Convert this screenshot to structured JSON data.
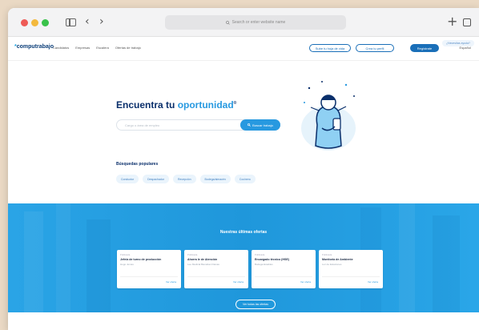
{
  "browser": {
    "address_placeholder": "Search or enter website name"
  },
  "site": {
    "logo": "computrabajo",
    "nav_links": [
      "Candidatos",
      "Empresas",
      "Escalera",
      "Ofertas de trabajo"
    ],
    "buttons": {
      "upload_cv": "Sube tu hoja de vida",
      "create_profile": "Crea tu perfil",
      "register": "Regístrate"
    },
    "language": "Español",
    "help_chip": "¿Necesitas ayuda?"
  },
  "hero": {
    "title_main": "Encuentra tu ",
    "title_accent": "oportunidad",
    "title_mark": "®",
    "search_placeholder": "Cargo o área de empleo",
    "search_button": "Buscar trabajo"
  },
  "popular": {
    "title": "Búsquedas populares",
    "chips": [
      "Conductor",
      "Despachador",
      "Recepción",
      "Bodega/almacén",
      "Cocinero"
    ]
  },
  "offers": {
    "title": "Nuestras últimas ofertas",
    "cards": [
      {
        "label": "Publicada",
        "title": "Jefe/a de turno de producción",
        "company": "Hugo Jemas",
        "more": "Ver oferta"
      },
      {
        "label": "Publicada",
        "title": "Ahorra le de Atención",
        "company": "Lee Medical Bienaban Dianas",
        "more": "Ver oferta"
      },
      {
        "label": "Publicada",
        "title": "Encargado técnico (HSE)",
        "company": "Bodega Estables",
        "more": "Ver oferta"
      },
      {
        "label": "Publicada",
        "title": "Monitor/a de Ambiente",
        "company": "Luz de Estaciones",
        "more": "Ver oferta"
      }
    ],
    "see_all": "Ver todas las ofertas"
  },
  "colors": {
    "brand_dark": "#0a2f6b",
    "accent": "#2799e0",
    "band": "#1f97db"
  }
}
